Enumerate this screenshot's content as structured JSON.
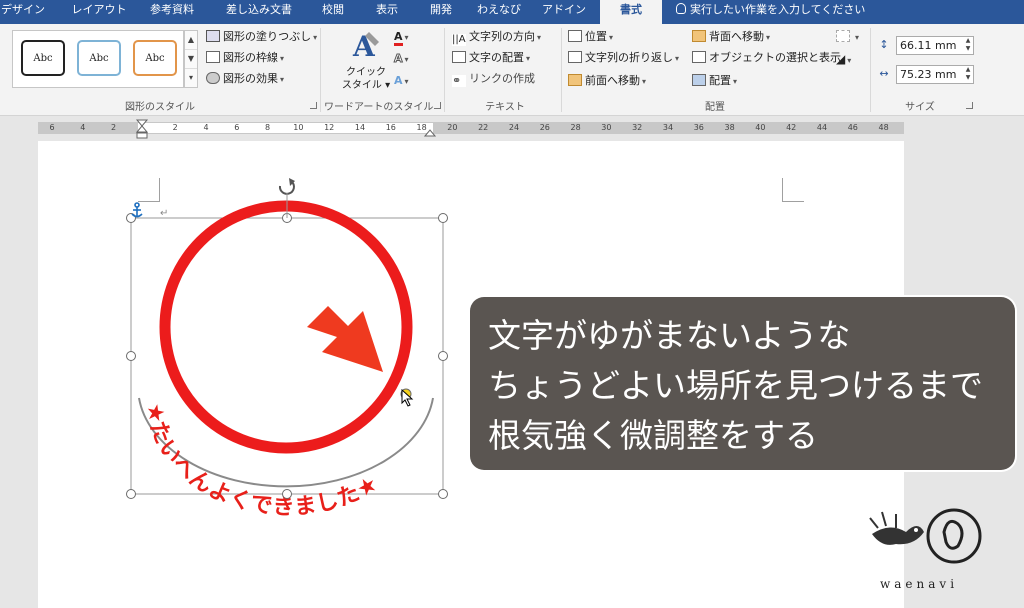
{
  "tabs": [
    "デザイン",
    "レイアウト",
    "参考資料",
    "差し込み文書",
    "校閲",
    "表示",
    "開発",
    "わえなび",
    "アドイン",
    "書式"
  ],
  "active_tab": "書式",
  "tell_me": "実行したい作業を入力してください",
  "ribbon": {
    "shape_styles": {
      "label": "図形のスタイル",
      "gallery_item": "Abc",
      "fill": "図形の塗りつぶし",
      "outline": "図形の枠線",
      "effects": "図形の効果"
    },
    "wordart": {
      "label": "ワードアートのスタイル",
      "quick_style_line1": "クイック",
      "quick_style_line2": "スタイル"
    },
    "text": {
      "label": "テキスト",
      "direction": "文字列の方向",
      "align": "文字の配置",
      "link": "リンクの作成"
    },
    "arrange": {
      "label": "配置",
      "position": "位置",
      "wrap": "文字列の折り返し",
      "bring_forward": "前面へ移動",
      "send_backward": "背面へ移動",
      "selection_pane": "オブジェクトの選択と表示",
      "align": "配置"
    },
    "size": {
      "label": "サイズ",
      "height": "66.11 mm",
      "width": "75.23 mm"
    }
  },
  "ruler_ticks": [
    "6",
    "4",
    "2",
    "",
    "2",
    "4",
    "6",
    "8",
    "10",
    "12",
    "14",
    "16",
    "18",
    "20",
    "22",
    "24",
    "26",
    "28",
    "30",
    "32",
    "34",
    "36",
    "38",
    "40",
    "42",
    "44",
    "46",
    "48"
  ],
  "shape": {
    "arc_text": "★たいへんよくできました★",
    "paragraph_mark": "↵",
    "colors": {
      "ring": "#ec1c1c",
      "arrow": "#ef3a1f",
      "arc": "#8a8a8a",
      "text": "#e8201a"
    }
  },
  "callout": {
    "lines": [
      "文字がゆがまないような",
      "ちょうどよい場所を見つけるまで",
      "根気強く微調整をする"
    ]
  },
  "logo": "waenavi"
}
